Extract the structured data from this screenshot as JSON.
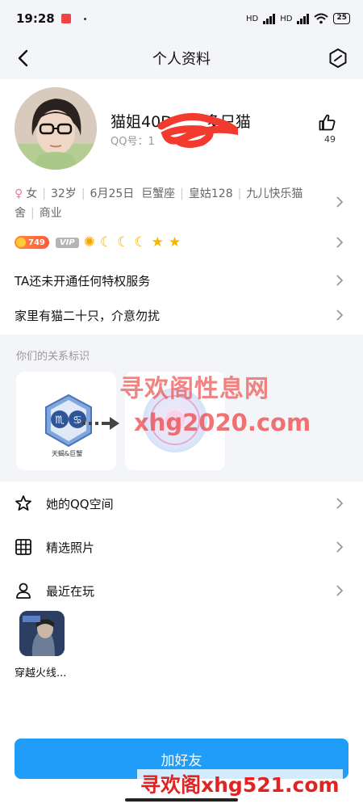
{
  "status_bar": {
    "time": "19:28",
    "net1": "HD",
    "net2": "HD",
    "battery": "25"
  },
  "nav": {
    "title": "个人资料"
  },
  "profile": {
    "name": "猫姐40D",
    "name_tail": "多只猫",
    "qq_label": "QQ号：1",
    "like_count": "49"
  },
  "info": {
    "gender": "女",
    "age": "32岁",
    "birthday": "6月25日",
    "zodiac": "巨蟹座",
    "location": "皇姑128",
    "company": "九儿快乐猫舍",
    "industry": "商业"
  },
  "badges": {
    "coin_level": "749",
    "vip": "VIP"
  },
  "privilege_text": "TA还未开通任何特权服务",
  "signature": "家里有猫二十只，介意勿扰",
  "relation": {
    "label": "你们的关系标识",
    "card1_caption": "天蝎&巨蟹"
  },
  "list": {
    "qzone": "她的QQ空间",
    "photos": "精选照片",
    "playing": "最近在玩"
  },
  "game": {
    "name": "穿越火线..."
  },
  "add_friend": "加好友",
  "watermarks": {
    "line1": "寻欢阁性息网",
    "line2": "xhg2020.com",
    "line3": "寻欢阁xhg521.com"
  },
  "colors": {
    "accent": "#1f9df8",
    "bg_gray": "#f4f5f8"
  }
}
